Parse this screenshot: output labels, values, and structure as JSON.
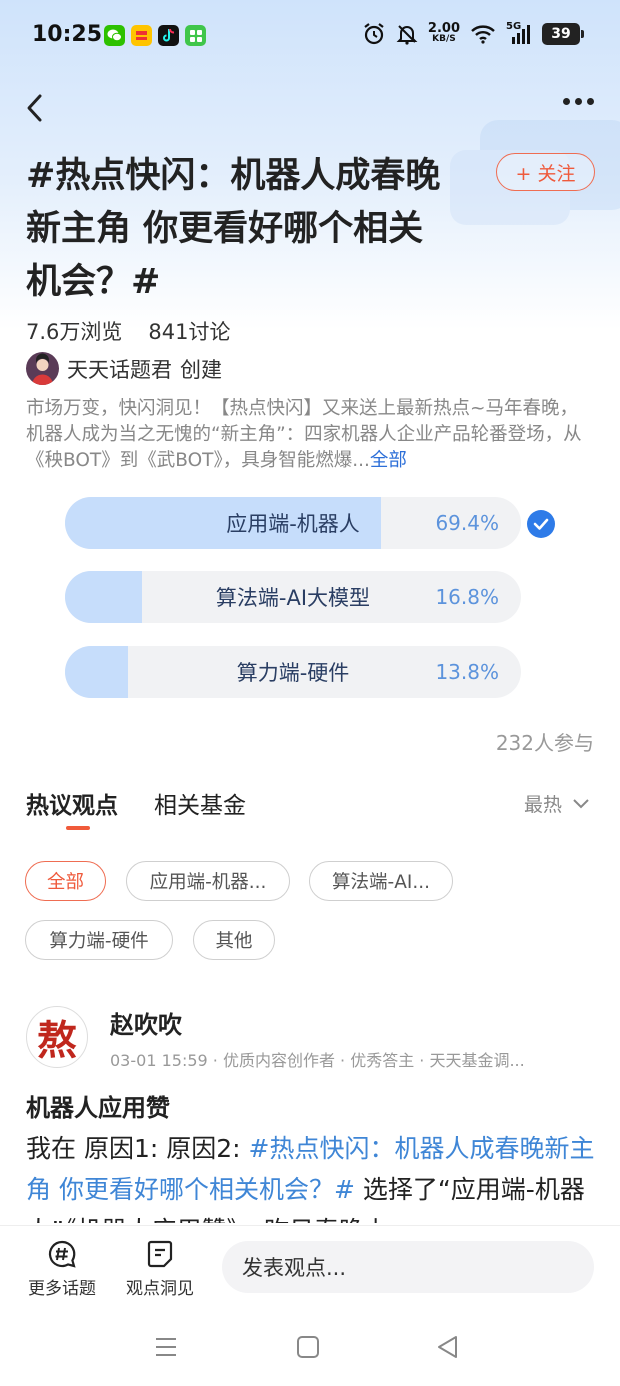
{
  "status_bar": {
    "time": "10:25",
    "net_speed": "2.00",
    "net_unit": "KB/S",
    "signal_label": "5G",
    "battery": "39",
    "icons": [
      "wechat-icon",
      "app-icon",
      "tiktok-icon",
      "app-store-icon",
      "alarm-icon",
      "mute-icon",
      "wifi-icon",
      "signal-icon",
      "battery-icon"
    ]
  },
  "topic": {
    "title": "#热点快闪：机器人成春晚新主角 你更看好哪个相关机会？#",
    "title_lines": [
      "#热点快闪：机器人成春晚",
      "新主角 你更看好哪个相关",
      "机会？#"
    ],
    "follow_label": "+ 关注",
    "views": "7.6万浏览",
    "discussions": "841讨论",
    "creator_name": "天天话题君",
    "creator_suffix": "创建",
    "description": "市场万变，快闪洞见！【热点快闪】又来送上最新热点~马年春晚，机器人成为当之无愧的“新主角”：四家机器人企业产品轮番登场，从《秧BOT》到《武BOT》，具身智能燃爆...",
    "expand_label": "全部"
  },
  "poll": {
    "options": [
      {
        "label": "应用端-机器人",
        "percent_text": "69.4%",
        "percent": 69.4,
        "selected": true
      },
      {
        "label": "算法端-AI大模型",
        "percent_text": "16.8%",
        "percent": 16.8,
        "selected": false
      },
      {
        "label": "算力端-硬件",
        "percent_text": "13.8%",
        "percent": 13.8,
        "selected": false
      }
    ],
    "participants": "232人参与"
  },
  "tabs": [
    {
      "label": "热议观点",
      "active": true
    },
    {
      "label": "相关基金",
      "active": false
    }
  ],
  "sort_label": "最热",
  "filter_chips": [
    "全部",
    "应用端-机器...",
    "算法端-AI...",
    "算力端-硬件",
    "其他"
  ],
  "post": {
    "avatar_char": "熬",
    "author": "赵吹吹",
    "meta": "03-01 15:59 · 优质内容创作者 · 优秀答主 · 天天基金调...",
    "title": "机器人应用赞",
    "body_prefix": "我在 原因1: 原因2: ",
    "body_tag": "#热点快闪：机器人成春晚新主角 你更看好哪个相关机会？#",
    "body_suffix": " 选择了“应用端-机器人”《机器人应用赞》，昨日春晚上"
  },
  "bottom_bar": {
    "more_topics": "更多话题",
    "insights": "观点洞见",
    "comment_placeholder": "发表观点..."
  },
  "colors": {
    "accent_orange": "#ef5a3c",
    "poll_fill": "#c6ddfb",
    "poll_percent": "#5c93dc",
    "link_blue": "#3f86d6"
  }
}
